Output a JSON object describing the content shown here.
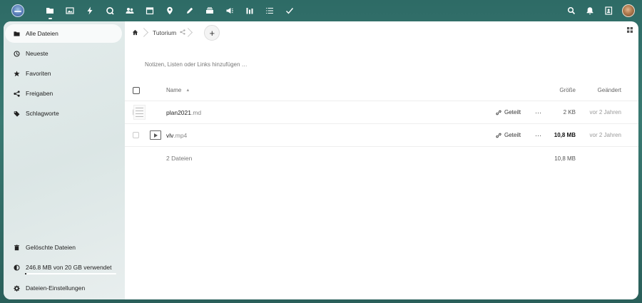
{
  "topbar": {
    "apps": [
      {
        "icon": "files-icon",
        "active": true
      },
      {
        "icon": "photos-icon"
      },
      {
        "icon": "activity-icon"
      },
      {
        "icon": "search-talk-icon"
      },
      {
        "icon": "contacts-icon"
      },
      {
        "icon": "calendar-icon"
      },
      {
        "icon": "maps-icon"
      },
      {
        "icon": "notes-edit-icon"
      },
      {
        "icon": "deck-icon"
      },
      {
        "icon": "announcement-icon"
      },
      {
        "icon": "analytics-icon"
      },
      {
        "icon": "list-icon"
      },
      {
        "icon": "tasks-check-icon"
      }
    ],
    "right": [
      "search-icon",
      "notifications-icon",
      "contacts-menu-icon"
    ]
  },
  "sidebar": {
    "items": [
      {
        "label": "Alle Dateien",
        "icon": "folder-icon",
        "active": true
      },
      {
        "label": "Neueste",
        "icon": "clock-icon"
      },
      {
        "label": "Favoriten",
        "icon": "star-icon"
      },
      {
        "label": "Freigaben",
        "icon": "share-icon"
      },
      {
        "label": "Schlagworte",
        "icon": "tag-icon"
      }
    ],
    "deleted": "Gelöschte Dateien",
    "quota": "246.8 MB von 20 GB verwendet",
    "quota_fraction": 0.012,
    "settings": "Dateien-Einstellungen"
  },
  "breadcrumb": {
    "folder": "Tutorium"
  },
  "notes_placeholder": "Notizen, Listen oder Links hinzufügen …",
  "table": {
    "headers": {
      "name": "Name",
      "size": "Größe",
      "modified": "Geändert"
    },
    "rows": [
      {
        "basename": "plan2021",
        "ext": ".md",
        "shared": "Geteilt",
        "size": "2 KB",
        "modified": "vor 2 Jahren"
      },
      {
        "basename": "vlv",
        "ext": ".mp4",
        "shared": "Geteilt",
        "size": "10,8 MB",
        "modified": "vor 2 Jahren"
      }
    ],
    "summary": {
      "count": "2 Dateien",
      "size": "10,8 MB"
    }
  }
}
